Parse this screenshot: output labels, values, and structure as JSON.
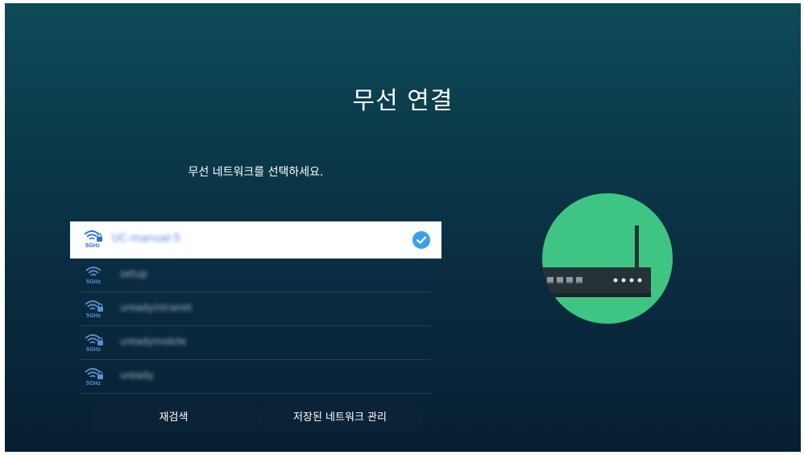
{
  "header": {
    "title": "무선 연결",
    "subtitle": "무선 네트워크를 선택하세요."
  },
  "networks": [
    {
      "ssid": "UC-manual-5",
      "band": "5GHz",
      "selected": true,
      "icon": "wifi-lock-icon"
    },
    {
      "ssid": "setup",
      "band": "5GHz",
      "selected": false,
      "icon": "wifi-icon"
    },
    {
      "ssid": "ureadyintranet",
      "band": "5GHz",
      "selected": false,
      "icon": "wifi-lock-icon"
    },
    {
      "ssid": "ureadymobile",
      "band": "5GHz",
      "selected": false,
      "icon": "wifi-lock-icon"
    },
    {
      "ssid": "uready",
      "band": "5GHz",
      "selected": false,
      "icon": "wifi-lock-icon"
    }
  ],
  "actions": {
    "rescan_label": "재검색",
    "saved_networks_label": "저장된 네트워크 관리"
  },
  "colors": {
    "accent": "#3aa0e8",
    "router_circle": "#3ec583",
    "router_body": "#263238",
    "background_top": "#0e4a58",
    "background_bottom": "#081f33"
  },
  "illustration": {
    "icon": "router-icon"
  }
}
